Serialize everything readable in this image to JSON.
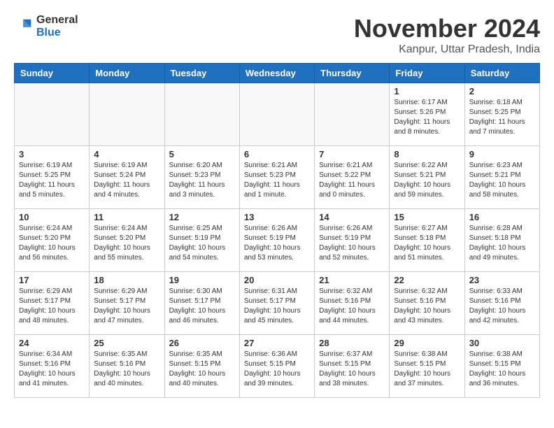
{
  "logo": {
    "general": "General",
    "blue": "Blue"
  },
  "title": "November 2024",
  "subtitle": "Kanpur, Uttar Pradesh, India",
  "headers": [
    "Sunday",
    "Monday",
    "Tuesday",
    "Wednesday",
    "Thursday",
    "Friday",
    "Saturday"
  ],
  "weeks": [
    [
      {
        "day": "",
        "info": ""
      },
      {
        "day": "",
        "info": ""
      },
      {
        "day": "",
        "info": ""
      },
      {
        "day": "",
        "info": ""
      },
      {
        "day": "",
        "info": ""
      },
      {
        "day": "1",
        "info": "Sunrise: 6:17 AM\nSunset: 5:26 PM\nDaylight: 11 hours and 8 minutes."
      },
      {
        "day": "2",
        "info": "Sunrise: 6:18 AM\nSunset: 5:25 PM\nDaylight: 11 hours and 7 minutes."
      }
    ],
    [
      {
        "day": "3",
        "info": "Sunrise: 6:19 AM\nSunset: 5:25 PM\nDaylight: 11 hours and 5 minutes."
      },
      {
        "day": "4",
        "info": "Sunrise: 6:19 AM\nSunset: 5:24 PM\nDaylight: 11 hours and 4 minutes."
      },
      {
        "day": "5",
        "info": "Sunrise: 6:20 AM\nSunset: 5:23 PM\nDaylight: 11 hours and 3 minutes."
      },
      {
        "day": "6",
        "info": "Sunrise: 6:21 AM\nSunset: 5:23 PM\nDaylight: 11 hours and 1 minute."
      },
      {
        "day": "7",
        "info": "Sunrise: 6:21 AM\nSunset: 5:22 PM\nDaylight: 11 hours and 0 minutes."
      },
      {
        "day": "8",
        "info": "Sunrise: 6:22 AM\nSunset: 5:21 PM\nDaylight: 10 hours and 59 minutes."
      },
      {
        "day": "9",
        "info": "Sunrise: 6:23 AM\nSunset: 5:21 PM\nDaylight: 10 hours and 58 minutes."
      }
    ],
    [
      {
        "day": "10",
        "info": "Sunrise: 6:24 AM\nSunset: 5:20 PM\nDaylight: 10 hours and 56 minutes."
      },
      {
        "day": "11",
        "info": "Sunrise: 6:24 AM\nSunset: 5:20 PM\nDaylight: 10 hours and 55 minutes."
      },
      {
        "day": "12",
        "info": "Sunrise: 6:25 AM\nSunset: 5:19 PM\nDaylight: 10 hours and 54 minutes."
      },
      {
        "day": "13",
        "info": "Sunrise: 6:26 AM\nSunset: 5:19 PM\nDaylight: 10 hours and 53 minutes."
      },
      {
        "day": "14",
        "info": "Sunrise: 6:26 AM\nSunset: 5:19 PM\nDaylight: 10 hours and 52 minutes."
      },
      {
        "day": "15",
        "info": "Sunrise: 6:27 AM\nSunset: 5:18 PM\nDaylight: 10 hours and 51 minutes."
      },
      {
        "day": "16",
        "info": "Sunrise: 6:28 AM\nSunset: 5:18 PM\nDaylight: 10 hours and 49 minutes."
      }
    ],
    [
      {
        "day": "17",
        "info": "Sunrise: 6:29 AM\nSunset: 5:17 PM\nDaylight: 10 hours and 48 minutes."
      },
      {
        "day": "18",
        "info": "Sunrise: 6:29 AM\nSunset: 5:17 PM\nDaylight: 10 hours and 47 minutes."
      },
      {
        "day": "19",
        "info": "Sunrise: 6:30 AM\nSunset: 5:17 PM\nDaylight: 10 hours and 46 minutes."
      },
      {
        "day": "20",
        "info": "Sunrise: 6:31 AM\nSunset: 5:17 PM\nDaylight: 10 hours and 45 minutes."
      },
      {
        "day": "21",
        "info": "Sunrise: 6:32 AM\nSunset: 5:16 PM\nDaylight: 10 hours and 44 minutes."
      },
      {
        "day": "22",
        "info": "Sunrise: 6:32 AM\nSunset: 5:16 PM\nDaylight: 10 hours and 43 minutes."
      },
      {
        "day": "23",
        "info": "Sunrise: 6:33 AM\nSunset: 5:16 PM\nDaylight: 10 hours and 42 minutes."
      }
    ],
    [
      {
        "day": "24",
        "info": "Sunrise: 6:34 AM\nSunset: 5:16 PM\nDaylight: 10 hours and 41 minutes."
      },
      {
        "day": "25",
        "info": "Sunrise: 6:35 AM\nSunset: 5:16 PM\nDaylight: 10 hours and 40 minutes."
      },
      {
        "day": "26",
        "info": "Sunrise: 6:35 AM\nSunset: 5:15 PM\nDaylight: 10 hours and 40 minutes."
      },
      {
        "day": "27",
        "info": "Sunrise: 6:36 AM\nSunset: 5:15 PM\nDaylight: 10 hours and 39 minutes."
      },
      {
        "day": "28",
        "info": "Sunrise: 6:37 AM\nSunset: 5:15 PM\nDaylight: 10 hours and 38 minutes."
      },
      {
        "day": "29",
        "info": "Sunrise: 6:38 AM\nSunset: 5:15 PM\nDaylight: 10 hours and 37 minutes."
      },
      {
        "day": "30",
        "info": "Sunrise: 6:38 AM\nSunset: 5:15 PM\nDaylight: 10 hours and 36 minutes."
      }
    ]
  ]
}
